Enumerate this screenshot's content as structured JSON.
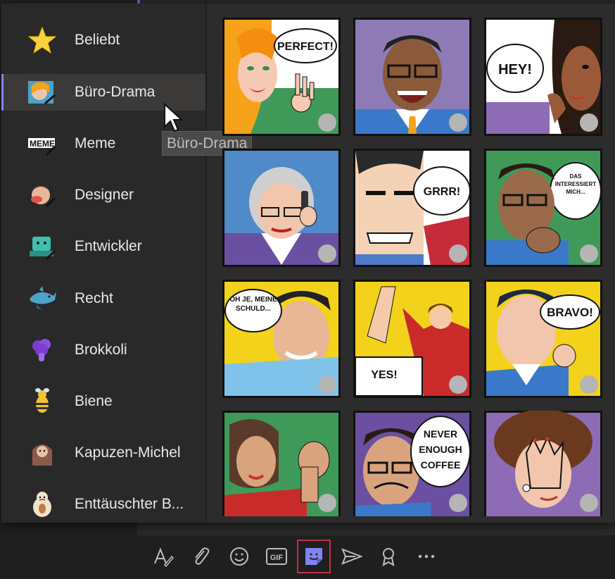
{
  "categories": [
    {
      "label": "Beliebt",
      "icon": "star-icon"
    },
    {
      "label": "Büro-Drama",
      "icon": "office-drama-icon"
    },
    {
      "label": "Meme",
      "icon": "meme-icon"
    },
    {
      "label": "Designer",
      "icon": "designer-icon"
    },
    {
      "label": "Entwickler",
      "icon": "developer-icon"
    },
    {
      "label": "Recht",
      "icon": "shark-icon"
    },
    {
      "label": "Brokkoli",
      "icon": "broccoli-icon"
    },
    {
      "label": "Biene",
      "icon": "bee-icon"
    },
    {
      "label": "Kapuzen-Michel",
      "icon": "hoodie-icon"
    },
    {
      "label": "Enttäuschter B...",
      "icon": "disappointed-icon"
    }
  ],
  "selected_category": "Büro-Drama",
  "tooltip": "Büro-Drama",
  "stickers": [
    {
      "caption": "PERFECT!"
    },
    {
      "caption": ""
    },
    {
      "caption": "HEY!"
    },
    {
      "caption": ""
    },
    {
      "caption": "GRRR!"
    },
    {
      "caption": "DAS INTERESSIERT MICH..."
    },
    {
      "caption": "OH JE, MEINE SCHULD..."
    },
    {
      "caption": "YES!"
    },
    {
      "caption": "BRAVO!"
    },
    {
      "caption": ""
    },
    {
      "caption": "NEVER ENOUGH COFFEE"
    },
    {
      "caption": ""
    }
  ],
  "toolbar": {
    "gif_label": "GIF",
    "buttons": [
      "format-icon",
      "attach-icon",
      "emoji-icon",
      "gif-icon",
      "sticker-icon",
      "send-icon",
      "praise-icon",
      "more-icon"
    ]
  },
  "colors": {
    "accent": "#7f85f5",
    "highlight": "#c4314b"
  }
}
